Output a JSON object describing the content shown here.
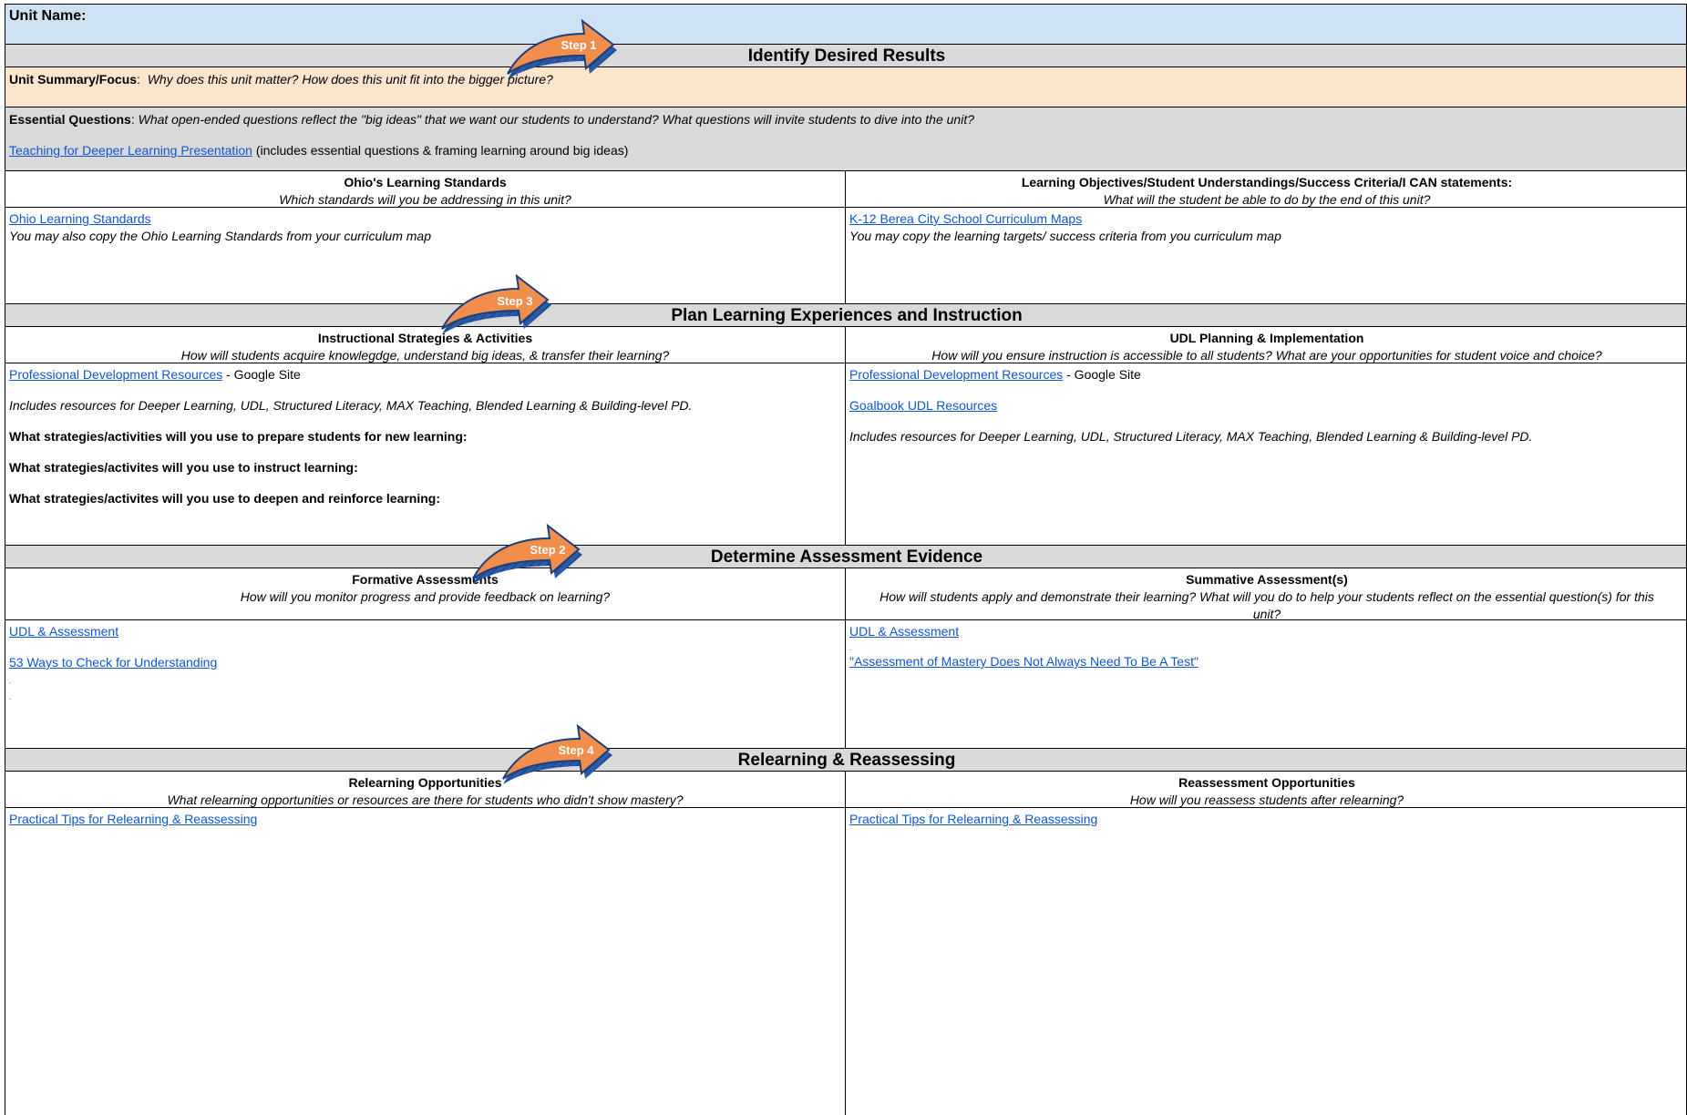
{
  "unit_name_label": "Unit Name:",
  "steps": {
    "step1": "Step 1",
    "step2": "Step 2",
    "step3": "Step 3",
    "step4": "Step 4"
  },
  "sections": {
    "desired_results": "Identify Desired Results",
    "plan_learning": "Plan Learning Experiences and Instruction",
    "assessment_evidence": "Determine Assessment Evidence",
    "relearning": "Relearning & Reassessing"
  },
  "summary": {
    "label": "Unit Summary/Focus",
    "colon": ":",
    "prompt": "Why does this unit matter?  How does this unit fit into the bigger picture?"
  },
  "essential": {
    "label": "Essential Questions",
    "colon": ":",
    "prompt": "What open-ended questions reflect the \"big ideas\" that we want our students to understand? What questions will invite students to dive into the unit?",
    "link": "Teaching for Deeper Learning Presentation",
    "link_note": " (includes essential questions & framing learning around big ideas)"
  },
  "standards": {
    "title": "Ohio's Learning Standards",
    "prompt": "Which standards will you be addressing in this unit?",
    "link": "Ohio Learning Standards",
    "note": "You may also copy the Ohio Learning Standards from your curriculum map"
  },
  "objectives": {
    "title": "Learning Objectives/Student Understandings/Success Criteria/I CAN statements:",
    "prompt": "What will the student be able to do by the end of this unit?",
    "link": "K-12 Berea City School Curriculum Maps",
    "note": "You may copy the learning targets/ success criteria from you curriculum map"
  },
  "strategies": {
    "title": "Instructional Strategies & Activities",
    "prompt": "How will students acquire knowlegdge, understand big ideas, & transfer their learning?",
    "link": "Professional Development Resources",
    "link_suffix": " - Google Site",
    "includes": "Includes resources for Deeper Learning, UDL, Structured Literacy, MAX Teaching, Blended Learning & Building-level PD.",
    "q1": "What strategies/activities will you use to prepare students for new learning:",
    "q2": "What strategies/activites will you use to instruct learning:",
    "q3": "What strategies/activites will you use to deepen and reinforce learning:"
  },
  "udl": {
    "title": "UDL Planning & Implementation",
    "prompt": "How will you ensure instruction is accessible to all students? What are your opportunities for student voice and choice?",
    "link": "Professional Development Resources",
    "link_suffix": " - Google Site",
    "link2": "Goalbook UDL Resources",
    "includes": "Includes resources for Deeper Learning, UDL, Structured Literacy, MAX Teaching, Blended Learning & Building-level PD."
  },
  "formative": {
    "title": "Formative Assessments",
    "prompt": "How will you monitor progress and provide feedback on learning?",
    "link1": "UDL & Assessment",
    "link2": "53 Ways to Check for Understanding",
    "dot": "."
  },
  "summative": {
    "title": "Summative Assessment(s)",
    "prompt": "How will students apply and demonstrate their learning? What will you do to help your students reflect on the essential question(s) for this unit?",
    "link1": "UDL & Assessment",
    "link2": "\"Assessment of Mastery Does Not Always Need To Be A Test\"",
    "dot": "."
  },
  "relearn": {
    "title": "Relearning Opportunities",
    "prompt": "What relearning opportunities or resources are there for students who didn't show mastery?",
    "link": "Practical Tips for Relearning & Reassessing"
  },
  "reassess": {
    "title": "Reassessment Opportunities",
    "prompt": "How will you reassess students after relearning?",
    "link": "Practical Tips for Relearning & Reassessing"
  },
  "colors": {
    "header_blue": "#cfe2f3",
    "section_grey": "#d9d9d9",
    "summary_peach": "#fce5cd",
    "link_blue": "#1155cc",
    "arrow_orange": "#f28e4c",
    "arrow_blue": "#2a5aa8"
  }
}
